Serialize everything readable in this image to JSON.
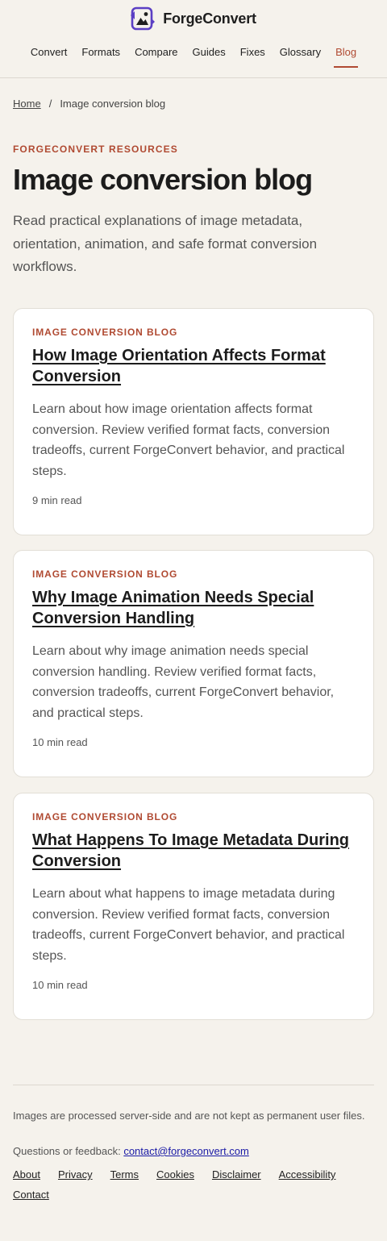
{
  "header": {
    "brand_name": "ForgeConvert",
    "nav": [
      {
        "label": "Convert",
        "active": false
      },
      {
        "label": "Formats",
        "active": false
      },
      {
        "label": "Compare",
        "active": false
      },
      {
        "label": "Guides",
        "active": false
      },
      {
        "label": "Fixes",
        "active": false
      },
      {
        "label": "Glossary",
        "active": false
      },
      {
        "label": "Blog",
        "active": true
      }
    ]
  },
  "breadcrumb": {
    "home": "Home",
    "separator": "/",
    "current": "Image conversion blog"
  },
  "hero": {
    "eyebrow": "FORGECONVERT RESOURCES",
    "title": "Image conversion blog",
    "intro": "Read practical explanations of image metadata, orientation, animation, and safe format conversion workflows."
  },
  "posts": [
    {
      "tag": "IMAGE CONVERSION BLOG",
      "title": "How Image Orientation Affects Format Conversion",
      "description": "Learn about how image orientation affects format conversion. Review verified format facts, conversion tradeoffs, current ForgeConvert behavior, and practical steps.",
      "read_time": "9 min read"
    },
    {
      "tag": "IMAGE CONVERSION BLOG",
      "title": "Why Image Animation Needs Special Conversion Handling",
      "description": "Learn about why image animation needs special conversion handling. Review verified format facts, conversion tradeoffs, current ForgeConvert behavior, and practical steps.",
      "read_time": "10 min read"
    },
    {
      "tag": "IMAGE CONVERSION BLOG",
      "title": "What Happens To Image Metadata During Conversion",
      "description": "Learn about what happens to image metadata during conversion. Review verified format facts, conversion tradeoffs, current ForgeConvert behavior, and practical steps.",
      "read_time": "10 min read"
    }
  ],
  "footer": {
    "note": "Images are processed server-side and are not kept as permanent user files.",
    "contact_prefix": "Questions or feedback: ",
    "contact_email": "contact@forgeconvert.com",
    "links": [
      "About",
      "Privacy",
      "Terms",
      "Cookies",
      "Disclaimer",
      "Accessibility",
      "Contact"
    ]
  },
  "colors": {
    "background": "#f5f2ec",
    "accent": "#b04a32",
    "logo_purple": "#5b3fc4",
    "card": "#ffffff"
  }
}
